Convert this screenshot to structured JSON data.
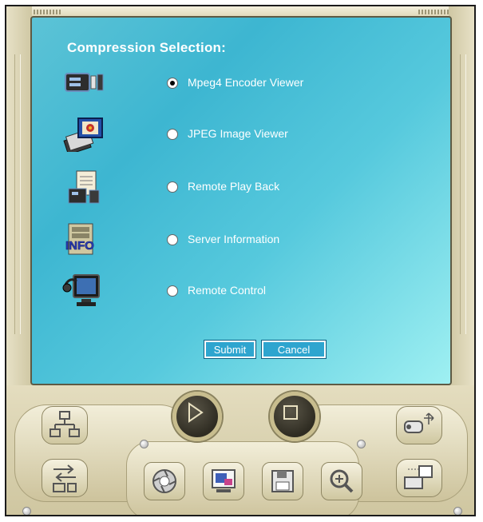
{
  "screen": {
    "heading": "Compression Selection:",
    "options": [
      {
        "label": "Mpeg4 Encoder Viewer",
        "icon": "video-camera-icon",
        "selected": true
      },
      {
        "label": "JPEG Image Viewer",
        "icon": "image-stack-icon",
        "selected": false
      },
      {
        "label": "Remote Play Back",
        "icon": "document-playback-icon",
        "selected": false
      },
      {
        "label": "Server Information",
        "icon": "info-server-icon",
        "selected": false
      },
      {
        "label": "Remote Control",
        "icon": "computer-monitor-icon",
        "selected": false
      }
    ],
    "submit_label": "Submit",
    "cancel_label": "Cancel"
  },
  "controls": {
    "play_icon": "play-icon",
    "stop_icon": "stop-icon",
    "left_buttons": [
      "network-icon",
      "transfer-icon"
    ],
    "bottom_buttons": [
      "aperture-icon",
      "monitor-video-icon",
      "save-icon",
      "zoom-in-icon"
    ],
    "right_buttons": [
      "ptz-camera-icon",
      "storage-icon"
    ]
  },
  "colors": {
    "screen_accent": "#3db6d1",
    "button_blue": "#2ea5cf",
    "bezel": "#ddd6b6"
  }
}
